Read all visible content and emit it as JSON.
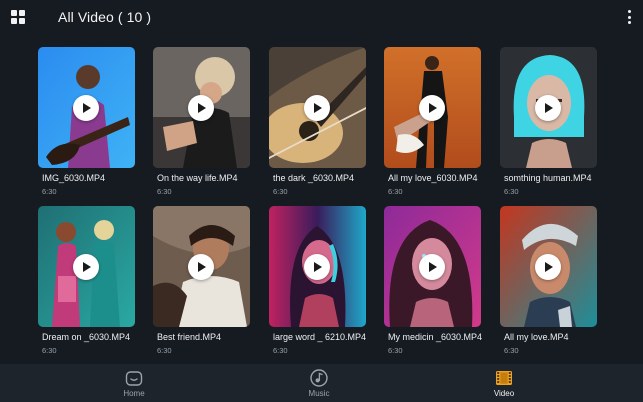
{
  "header": {
    "title": "All Video ( 10 )"
  },
  "videos": [
    {
      "name": "IMG_6030.MP4",
      "duration": "6:30"
    },
    {
      "name": "On the way life.MP4",
      "duration": "6:30"
    },
    {
      "name": "the dark _6030.MP4",
      "duration": "6:30"
    },
    {
      "name": "All my love_6030.MP4",
      "duration": "6:30"
    },
    {
      "name": "somthing human.MP4",
      "duration": "6:30"
    },
    {
      "name": "Dream on _6030.MP4",
      "duration": "6:30"
    },
    {
      "name": "Best friend.MP4",
      "duration": "6:30"
    },
    {
      "name": "large word _ 6210.MP4",
      "duration": "6:30"
    },
    {
      "name": "My medicin _6030.MP4",
      "duration": "6:30"
    },
    {
      "name": "All my love.MP4",
      "duration": "6:30"
    }
  ],
  "nav": {
    "home": "Home",
    "music": "Music",
    "video": "Video",
    "active": "video"
  },
  "icons": {
    "menu": "grid-icon",
    "more": "more-vertical-icon",
    "play": "play-icon",
    "home": "home-icon",
    "music": "music-note-icon",
    "video": "film-icon"
  },
  "colors": {
    "background": "#161b22",
    "bottom_bar": "#1e242c",
    "active_accent": "#f0a21c",
    "inactive_icon": "#9da3a9"
  }
}
